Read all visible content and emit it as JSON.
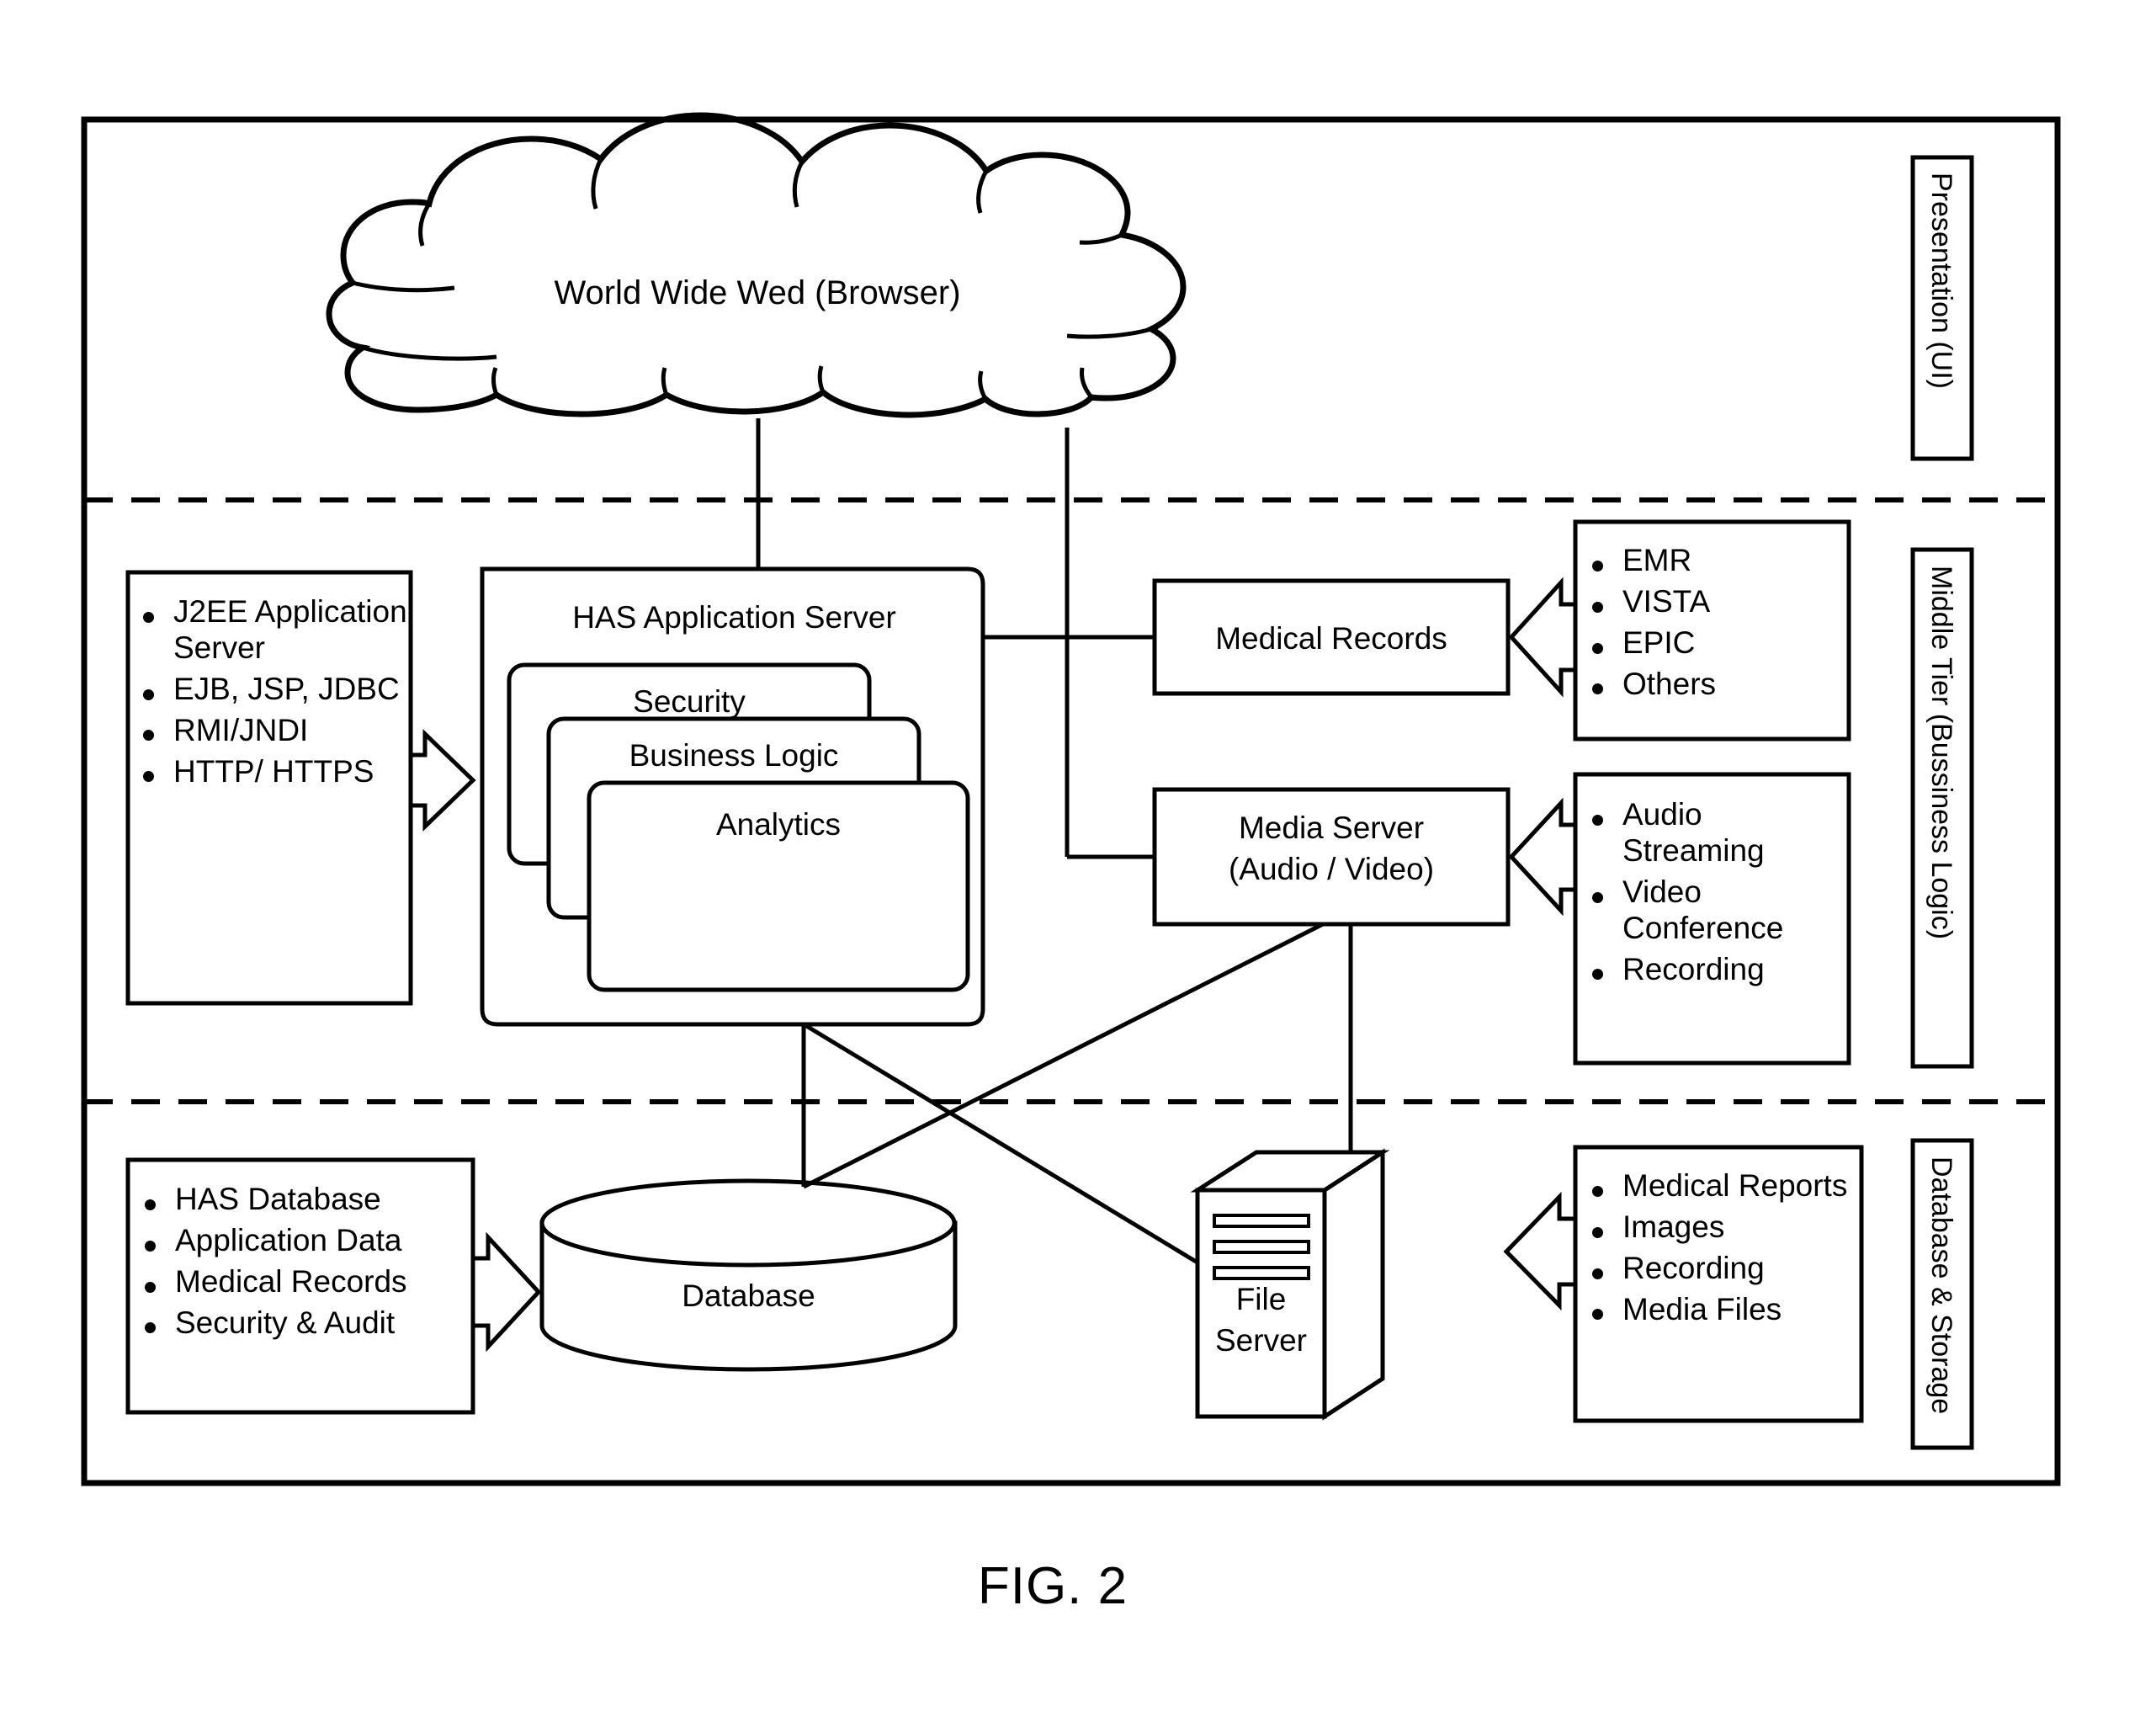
{
  "figure": {
    "caption": "FIG. 2"
  },
  "cloud": {
    "label": "World Wide Wed (Browser)"
  },
  "tiers": [
    {
      "id": "presentation",
      "label": "Presentation (UI)"
    },
    {
      "id": "middle",
      "label": "Middle Tier (Bussiness Logic)"
    },
    {
      "id": "storage",
      "label": "Database & Storage"
    }
  ],
  "middle_tier": {
    "tech_list": {
      "items": [
        "J2EE Application Server",
        "EJB, JSP, JDBC",
        "RMI/JNDI",
        "HTTP/ HTTPS"
      ]
    },
    "app_server": {
      "title": "HAS Application Server",
      "cards": [
        {
          "label": "Security"
        },
        {
          "label": "Business Logic"
        },
        {
          "label": "Analytics"
        }
      ]
    },
    "medical_records": {
      "label": "Medical Records"
    },
    "medical_records_list": {
      "items": [
        "EMR",
        "VISTA",
        "EPIC",
        "Others"
      ]
    },
    "media_server": {
      "line1": "Media Server",
      "line2": "(Audio / Video)"
    },
    "media_server_list": {
      "items": [
        "Audio Streaming",
        "Video Conference",
        "Recording"
      ]
    }
  },
  "storage_tier": {
    "db_list": {
      "items": [
        "HAS Database",
        "Application Data",
        "Medical Records",
        "Security & Audit"
      ]
    },
    "database": {
      "label": "Database"
    },
    "file_server": {
      "line1": "File",
      "line2": "Server"
    },
    "file_server_list": {
      "items": [
        "Medical Reports",
        "Images",
        "Recording",
        "Media Files"
      ]
    }
  },
  "colors": {
    "ink": "#000000",
    "paper": "#ffffff"
  }
}
